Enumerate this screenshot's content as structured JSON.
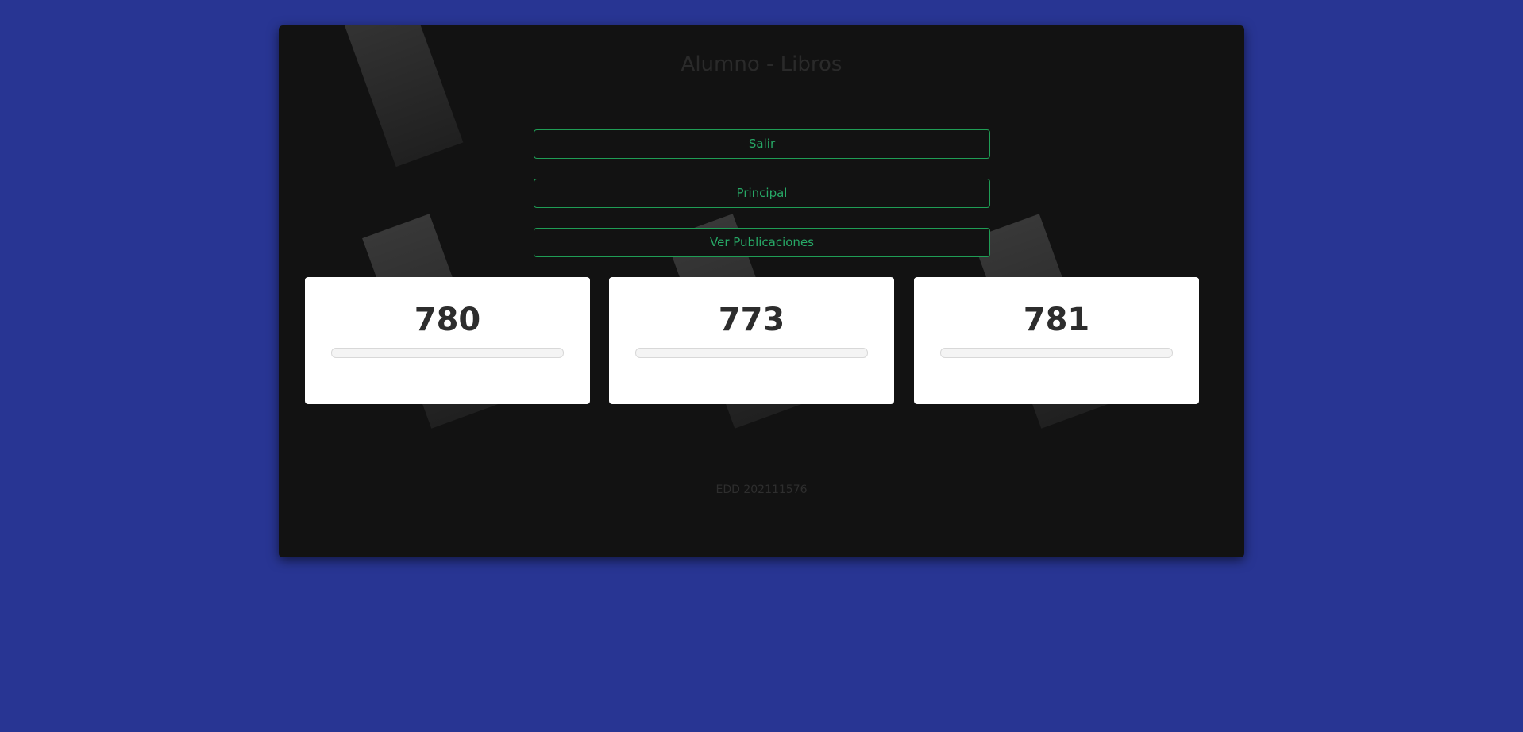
{
  "app": {
    "title": "Alumno - Libros"
  },
  "nav": {
    "buttons": [
      {
        "label": "Salir"
      },
      {
        "label": "Principal"
      },
      {
        "label": "Ver Publicaciones"
      }
    ]
  },
  "cards": [
    {
      "value": "780",
      "progress": 0
    },
    {
      "value": "773",
      "progress": 0
    },
    {
      "value": "781",
      "progress": 0
    }
  ],
  "footer": {
    "text": "EDD 202111576"
  },
  "colors": {
    "page_background": "#283593",
    "panel_background": "#121212",
    "button_accent": "#1f9d55",
    "card_background": "#ffffff"
  }
}
